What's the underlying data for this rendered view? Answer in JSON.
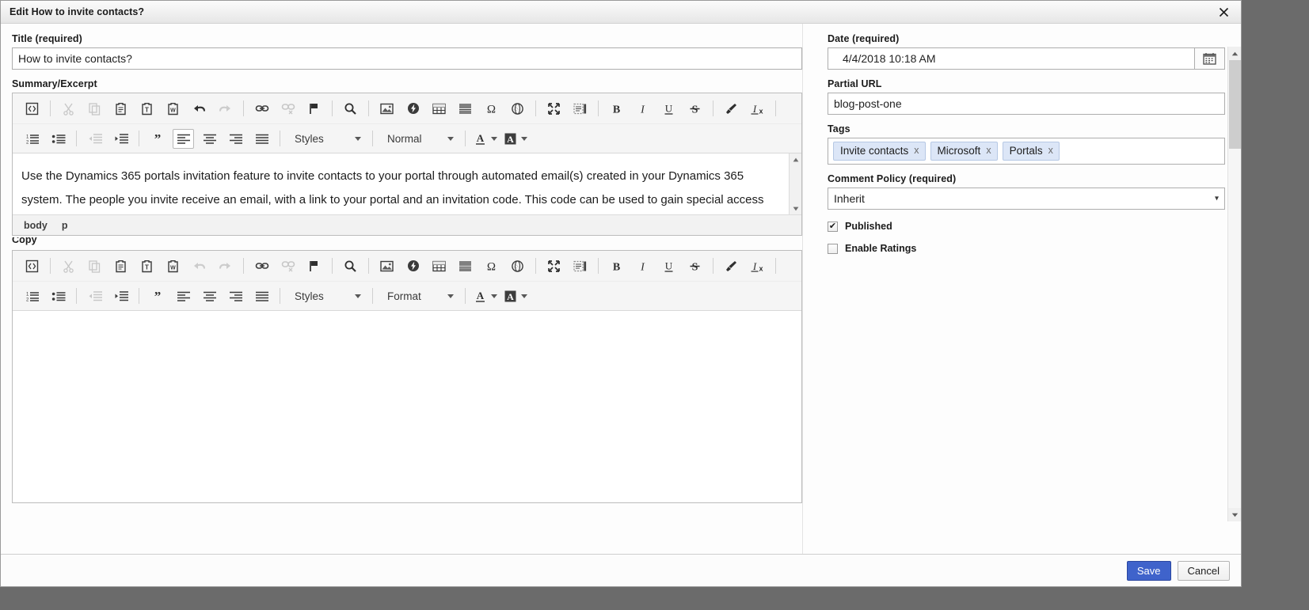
{
  "window": {
    "title": "Edit How to invite contacts?",
    "close_icon": "close-icon"
  },
  "left": {
    "title_field": {
      "label": "Title (required)",
      "value": "How to invite contacts?",
      "placeholder": ""
    },
    "summary_field": {
      "label": "Summary/Excerpt",
      "body_text": "Use the Dynamics 365 portals invitation feature to invite contacts to your portal through automated email(s) created in your Dynamics 365 system. The people you invite receive an email, with a link to your portal and an invitation code. This code can be used to gain special access configured by you. With this feature you have the ability to:",
      "status_path": [
        "body",
        "p"
      ],
      "styles_combo": "Styles",
      "format_combo": "Normal"
    },
    "copy_field": {
      "label": "Copy",
      "body_text": "",
      "styles_combo": "Styles",
      "format_combo": "Format"
    },
    "toolbar_row1": [
      {
        "name": "source-code-icon",
        "enabled": true
      },
      {
        "name": "separator"
      },
      {
        "name": "cut-icon",
        "enabled": false
      },
      {
        "name": "copy-icon",
        "enabled": false
      },
      {
        "name": "paste-icon",
        "enabled": true
      },
      {
        "name": "paste-as-plain-text-icon",
        "enabled": true
      },
      {
        "name": "paste-from-word-icon",
        "enabled": true
      },
      {
        "name": "undo-icon",
        "enabled": true
      },
      {
        "name": "redo-icon",
        "enabled": false
      },
      {
        "name": "separator"
      },
      {
        "name": "link-icon",
        "enabled": true
      },
      {
        "name": "unlink-icon",
        "enabled": false
      },
      {
        "name": "anchor-flag-icon",
        "enabled": true
      },
      {
        "name": "separator"
      },
      {
        "name": "find-search-icon",
        "enabled": true
      },
      {
        "name": "separator"
      },
      {
        "name": "image-icon",
        "enabled": true
      },
      {
        "name": "flash-icon",
        "enabled": true
      },
      {
        "name": "table-icon",
        "enabled": true
      },
      {
        "name": "horizontal-rule-icon",
        "enabled": true
      },
      {
        "name": "special-character-icon",
        "enabled": true
      },
      {
        "name": "iframe-globe-icon",
        "enabled": true
      },
      {
        "name": "separator"
      },
      {
        "name": "maximize-icon",
        "enabled": true
      },
      {
        "name": "show-blocks-icon",
        "enabled": true
      },
      {
        "name": "separator"
      },
      {
        "name": "bold-icon",
        "enabled": true
      },
      {
        "name": "italic-icon",
        "enabled": true
      },
      {
        "name": "underline-icon",
        "enabled": true
      },
      {
        "name": "strikethrough-icon",
        "enabled": true
      },
      {
        "name": "separator"
      },
      {
        "name": "copy-formatting-brush-icon",
        "enabled": true
      },
      {
        "name": "remove-format-icon",
        "enabled": true
      },
      {
        "name": "separator"
      }
    ],
    "toolbar_row2": [
      {
        "name": "numbered-list-icon",
        "enabled": true
      },
      {
        "name": "bulleted-list-icon",
        "enabled": true
      },
      {
        "name": "separator"
      },
      {
        "name": "outdent-icon",
        "enabled": false
      },
      {
        "name": "indent-icon",
        "enabled": true
      },
      {
        "name": "separator"
      },
      {
        "name": "blockquote-icon",
        "enabled": true
      },
      {
        "name": "align-left-icon",
        "enabled": true,
        "active": true
      },
      {
        "name": "align-center-icon",
        "enabled": true
      },
      {
        "name": "align-right-icon",
        "enabled": true
      },
      {
        "name": "align-justify-icon",
        "enabled": true
      },
      {
        "name": "separator"
      }
    ]
  },
  "right": {
    "date": {
      "label": "Date (required)",
      "value": "4/4/2018 10:18 AM",
      "picker_icon": "calendar-icon"
    },
    "partial_url": {
      "label": "Partial URL",
      "value": "blog-post-one"
    },
    "tags": {
      "label": "Tags",
      "items": [
        "Invite contacts",
        "Microsoft",
        "Portals"
      ],
      "remove_glyph": "x"
    },
    "comment_policy": {
      "label": "Comment Policy (required)",
      "value": "Inherit",
      "caret_glyph": "▾"
    },
    "published": {
      "label": "Published",
      "checked": true,
      "check_glyph": "✔"
    },
    "enable_ratings": {
      "label": "Enable Ratings",
      "checked": false,
      "check_glyph": ""
    }
  },
  "footer": {
    "save_label": "Save",
    "cancel_label": "Cancel"
  },
  "colors": {
    "primary_button": "#3f63cb",
    "tag_chip_bg": "#dce6f7",
    "tag_chip_border": "#b6c8e4",
    "window_bg": "#fdfdfd",
    "toolbar_bg": "#f5f5f5"
  }
}
